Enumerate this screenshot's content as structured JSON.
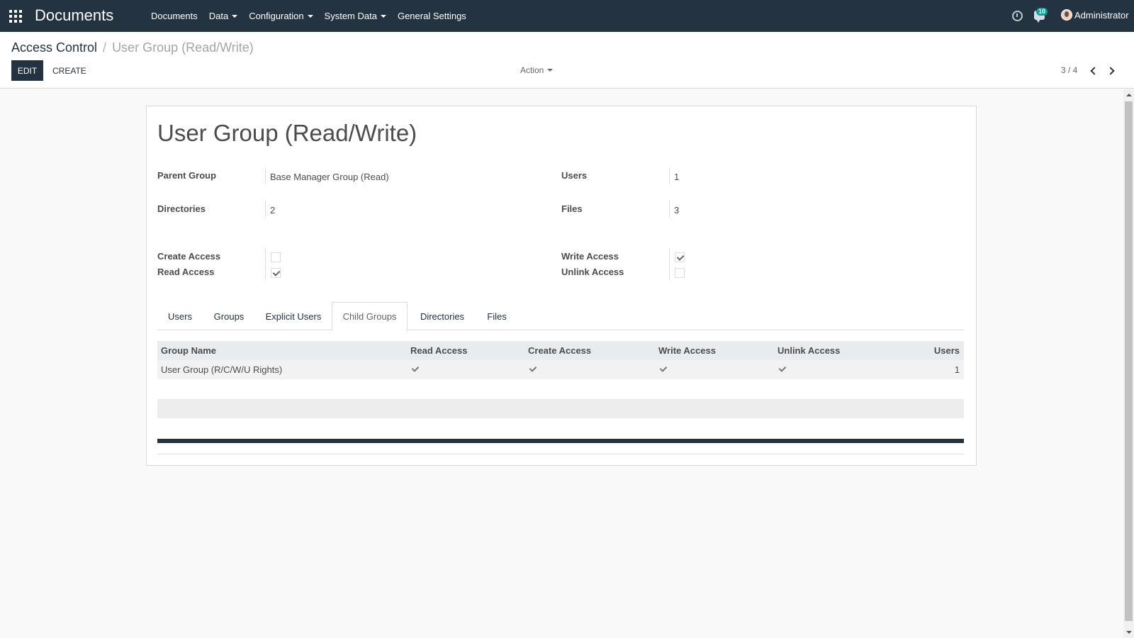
{
  "navbar": {
    "brand": "Documents",
    "menu": [
      "Documents",
      "Data",
      "Configuration",
      "System Data",
      "General Settings"
    ],
    "notification_count": "10",
    "user_name": "Administrator"
  },
  "breadcrumb": {
    "parent": "Access Control",
    "separator": "/",
    "current": "User Group (Read/Write)"
  },
  "buttons": {
    "edit": "EDIT",
    "create": "CREATE",
    "action": "Action"
  },
  "pager": {
    "value": "3 / 4"
  },
  "record": {
    "title": "User Group (Read/Write)",
    "fields": {
      "parent_group_label": "Parent Group",
      "parent_group_value": "Base Manager Group (Read)",
      "users_label": "Users",
      "users_value": "1",
      "directories_label": "Directories",
      "directories_value": "2",
      "files_label": "Files",
      "files_value": "3",
      "create_access_label": "Create Access",
      "create_access": false,
      "read_access_label": "Read Access",
      "read_access": true,
      "write_access_label": "Write Access",
      "write_access": true,
      "unlink_access_label": "Unlink Access",
      "unlink_access": false
    }
  },
  "tabs": [
    "Users",
    "Groups",
    "Explicit Users",
    "Child Groups",
    "Directories",
    "Files"
  ],
  "active_tab": "Child Groups",
  "child_groups_table": {
    "headers": [
      "Group Name",
      "Read Access",
      "Create Access",
      "Write Access",
      "Unlink Access",
      "Users"
    ],
    "rows": [
      {
        "name": "User Group (R/C/W/U Rights)",
        "read": true,
        "create": true,
        "write": true,
        "unlink": true,
        "users": "1"
      }
    ]
  },
  "colors": {
    "navbar": "#243341",
    "primary": "#243341",
    "badge": "#00a09d"
  }
}
